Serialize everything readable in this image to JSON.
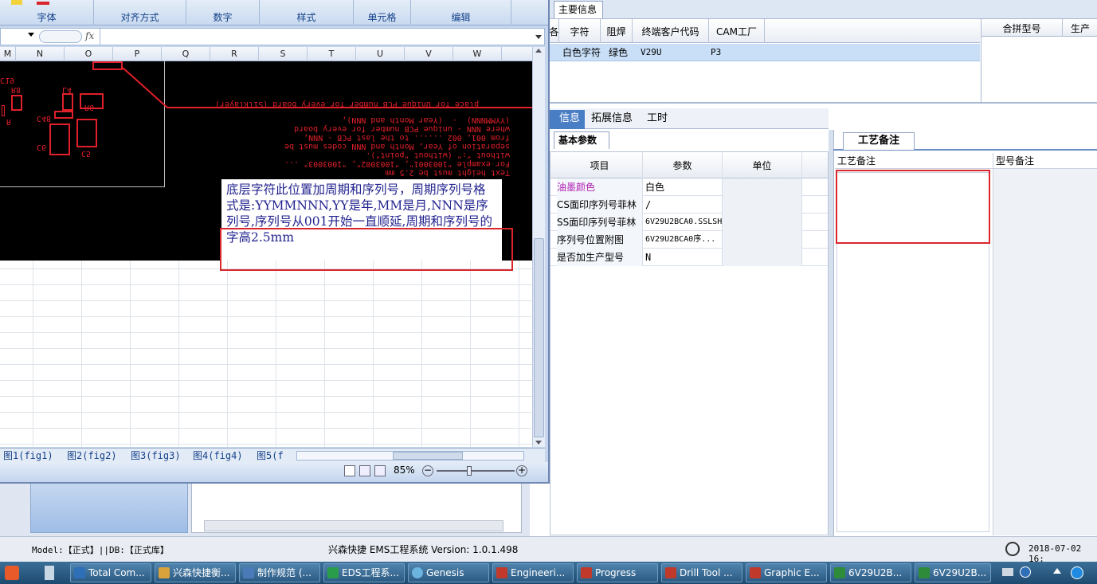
{
  "ems": {
    "tab_main_info": "主要信息",
    "grid_headers": [
      "各",
      "字符",
      "阻焊",
      "终端客户代码",
      "CAM工厂"
    ],
    "grid_headers_right": [
      "合拼型号",
      "生产"
    ],
    "grid_row": [
      "白色字符",
      "绿色",
      "V29U",
      "P3"
    ],
    "tabs": [
      "信息",
      "拓展信息",
      "工时"
    ],
    "subtab": "基本参数",
    "param_headers": [
      "项目",
      "参数",
      "单位"
    ],
    "param_rows": [
      {
        "item": "油墨颜色",
        "value": "白色",
        "highlight": true
      },
      {
        "item": "CS面印序列号菲林",
        "value": "/"
      },
      {
        "item": "SS面印序列号菲林",
        "value": "6V29U2BCA0.SSLSH"
      },
      {
        "item": "序列号位置附图",
        "value": "6V29U2BCA0序..."
      },
      {
        "item": "是否加生产型号",
        "value": "N"
      }
    ],
    "craft_tab": "工艺备注",
    "craft_col1": "工艺备注",
    "craft_col2": "型号备注",
    "status_model": "Model:【正式】||DB:【正式库】",
    "status_title": "兴森快捷 EMS工程系统 Version: 1.0.1.498",
    "status_date": "2018-07-02 16:"
  },
  "excel": {
    "ribbon_groups": [
      "字体",
      "对齐方式",
      "数字",
      "样式",
      "单元格",
      "编辑"
    ],
    "fx_label": "fx",
    "columns": [
      "M",
      "N",
      "O",
      "P",
      "Q",
      "R",
      "S",
      "T",
      "U",
      "V",
      "W"
    ],
    "silkscreen_lines": [
      "place for Unique PCB number for every board (Silklayer)",
      "(YYMMNNN)  -  (Year Month and NNN),",
      "where NNN - unique PCB number for every board",
      "from 001, 002 ...... to the last PCB - NNN,",
      "separation of Year, Month and NNN codes must be",
      "without \":\" (without \"point\").",
      "For example \"1003001\", \"1003002\", \"1003003\" ...",
      "Text height must be 2.5 mm"
    ],
    "pcb_labels": [
      "C19",
      "R8",
      "R6",
      "L4",
      "C48",
      "C6",
      "C5",
      "R"
    ],
    "note_text": "底层字符此位置加周期和序列号，周期序列号格式是:YYMMNNN,YY是年,MM是月,NNN是序列号,序列号从001开始一直顺延,周期和序列号的字高2.5mm",
    "sheet_tabs": [
      "图1(fig1)",
      "图2(fig2)",
      "图3(fig3)",
      "图4(fig4)",
      "图5(f"
    ],
    "zoom": "85%"
  },
  "taskbar": {
    "items": [
      "Total Com...",
      "兴森快捷衡...",
      "制作规范 (...",
      "EDS工程系...",
      "Genesis",
      "Engineeri...",
      "Progress",
      "Drill Tool ...",
      "Graphic E...",
      "6V29U2B...",
      "6V29U2B..."
    ],
    "colors": [
      "#2f6fb8",
      "#d9a23a",
      "#4a7ab8",
      "#2a9d4b",
      "#6bb4e0",
      "#c0392b",
      "#c0392b",
      "#c0392b",
      "#c0392b",
      "#2e8b3a",
      "#2e8b3a"
    ]
  }
}
